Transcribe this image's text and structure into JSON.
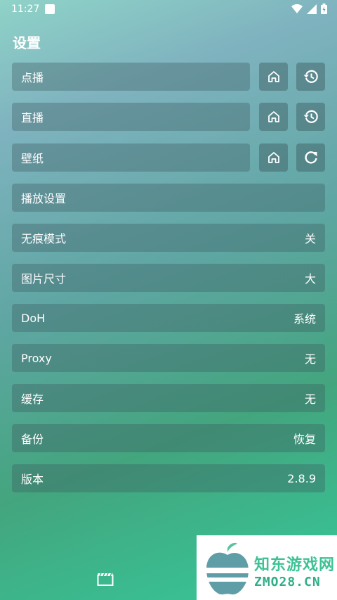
{
  "status": {
    "time": "11:27"
  },
  "page_title": "设置",
  "rows": [
    {
      "label": "点播",
      "value": ""
    },
    {
      "label": "直播",
      "value": ""
    },
    {
      "label": "壁纸",
      "value": ""
    },
    {
      "label": "播放设置",
      "value": ""
    },
    {
      "label": "无痕模式",
      "value": "关"
    },
    {
      "label": "图片尺寸",
      "value": "大"
    },
    {
      "label": "DoH",
      "value": "系统"
    },
    {
      "label": "Proxy",
      "value": "无"
    },
    {
      "label": "缓存",
      "value": "无"
    },
    {
      "label": "备份",
      "value": "恢复"
    },
    {
      "label": "版本",
      "value": "2.8.9"
    }
  ],
  "icons": {
    "home": "home-icon",
    "history": "history-icon",
    "refresh": "refresh-icon",
    "bottom": "clapperboard-icon"
  },
  "watermark": {
    "line1": "知东游戏网",
    "line2": "ZMO28.CN"
  }
}
